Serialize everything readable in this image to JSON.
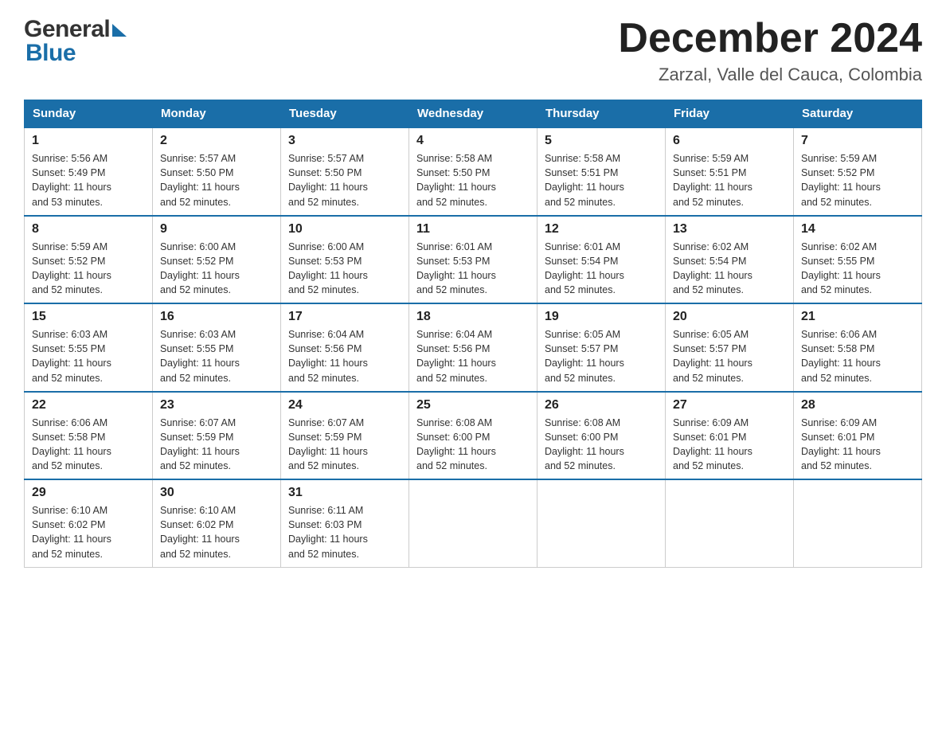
{
  "header": {
    "month_title": "December 2024",
    "location": "Zarzal, Valle del Cauca, Colombia",
    "logo_general": "General",
    "logo_blue": "Blue"
  },
  "weekdays": [
    "Sunday",
    "Monday",
    "Tuesday",
    "Wednesday",
    "Thursday",
    "Friday",
    "Saturday"
  ],
  "weeks": [
    [
      {
        "day": "1",
        "sunrise": "5:56 AM",
        "sunset": "5:49 PM",
        "daylight": "11 hours and 53 minutes."
      },
      {
        "day": "2",
        "sunrise": "5:57 AM",
        "sunset": "5:50 PM",
        "daylight": "11 hours and 52 minutes."
      },
      {
        "day": "3",
        "sunrise": "5:57 AM",
        "sunset": "5:50 PM",
        "daylight": "11 hours and 52 minutes."
      },
      {
        "day": "4",
        "sunrise": "5:58 AM",
        "sunset": "5:50 PM",
        "daylight": "11 hours and 52 minutes."
      },
      {
        "day": "5",
        "sunrise": "5:58 AM",
        "sunset": "5:51 PM",
        "daylight": "11 hours and 52 minutes."
      },
      {
        "day": "6",
        "sunrise": "5:59 AM",
        "sunset": "5:51 PM",
        "daylight": "11 hours and 52 minutes."
      },
      {
        "day": "7",
        "sunrise": "5:59 AM",
        "sunset": "5:52 PM",
        "daylight": "11 hours and 52 minutes."
      }
    ],
    [
      {
        "day": "8",
        "sunrise": "5:59 AM",
        "sunset": "5:52 PM",
        "daylight": "11 hours and 52 minutes."
      },
      {
        "day": "9",
        "sunrise": "6:00 AM",
        "sunset": "5:52 PM",
        "daylight": "11 hours and 52 minutes."
      },
      {
        "day": "10",
        "sunrise": "6:00 AM",
        "sunset": "5:53 PM",
        "daylight": "11 hours and 52 minutes."
      },
      {
        "day": "11",
        "sunrise": "6:01 AM",
        "sunset": "5:53 PM",
        "daylight": "11 hours and 52 minutes."
      },
      {
        "day": "12",
        "sunrise": "6:01 AM",
        "sunset": "5:54 PM",
        "daylight": "11 hours and 52 minutes."
      },
      {
        "day": "13",
        "sunrise": "6:02 AM",
        "sunset": "5:54 PM",
        "daylight": "11 hours and 52 minutes."
      },
      {
        "day": "14",
        "sunrise": "6:02 AM",
        "sunset": "5:55 PM",
        "daylight": "11 hours and 52 minutes."
      }
    ],
    [
      {
        "day": "15",
        "sunrise": "6:03 AM",
        "sunset": "5:55 PM",
        "daylight": "11 hours and 52 minutes."
      },
      {
        "day": "16",
        "sunrise": "6:03 AM",
        "sunset": "5:55 PM",
        "daylight": "11 hours and 52 minutes."
      },
      {
        "day": "17",
        "sunrise": "6:04 AM",
        "sunset": "5:56 PM",
        "daylight": "11 hours and 52 minutes."
      },
      {
        "day": "18",
        "sunrise": "6:04 AM",
        "sunset": "5:56 PM",
        "daylight": "11 hours and 52 minutes."
      },
      {
        "day": "19",
        "sunrise": "6:05 AM",
        "sunset": "5:57 PM",
        "daylight": "11 hours and 52 minutes."
      },
      {
        "day": "20",
        "sunrise": "6:05 AM",
        "sunset": "5:57 PM",
        "daylight": "11 hours and 52 minutes."
      },
      {
        "day": "21",
        "sunrise": "6:06 AM",
        "sunset": "5:58 PM",
        "daylight": "11 hours and 52 minutes."
      }
    ],
    [
      {
        "day": "22",
        "sunrise": "6:06 AM",
        "sunset": "5:58 PM",
        "daylight": "11 hours and 52 minutes."
      },
      {
        "day": "23",
        "sunrise": "6:07 AM",
        "sunset": "5:59 PM",
        "daylight": "11 hours and 52 minutes."
      },
      {
        "day": "24",
        "sunrise": "6:07 AM",
        "sunset": "5:59 PM",
        "daylight": "11 hours and 52 minutes."
      },
      {
        "day": "25",
        "sunrise": "6:08 AM",
        "sunset": "6:00 PM",
        "daylight": "11 hours and 52 minutes."
      },
      {
        "day": "26",
        "sunrise": "6:08 AM",
        "sunset": "6:00 PM",
        "daylight": "11 hours and 52 minutes."
      },
      {
        "day": "27",
        "sunrise": "6:09 AM",
        "sunset": "6:01 PM",
        "daylight": "11 hours and 52 minutes."
      },
      {
        "day": "28",
        "sunrise": "6:09 AM",
        "sunset": "6:01 PM",
        "daylight": "11 hours and 52 minutes."
      }
    ],
    [
      {
        "day": "29",
        "sunrise": "6:10 AM",
        "sunset": "6:02 PM",
        "daylight": "11 hours and 52 minutes."
      },
      {
        "day": "30",
        "sunrise": "6:10 AM",
        "sunset": "6:02 PM",
        "daylight": "11 hours and 52 minutes."
      },
      {
        "day": "31",
        "sunrise": "6:11 AM",
        "sunset": "6:03 PM",
        "daylight": "11 hours and 52 minutes."
      },
      null,
      null,
      null,
      null
    ]
  ],
  "labels": {
    "sunrise": "Sunrise:",
    "sunset": "Sunset:",
    "daylight": "Daylight:"
  }
}
